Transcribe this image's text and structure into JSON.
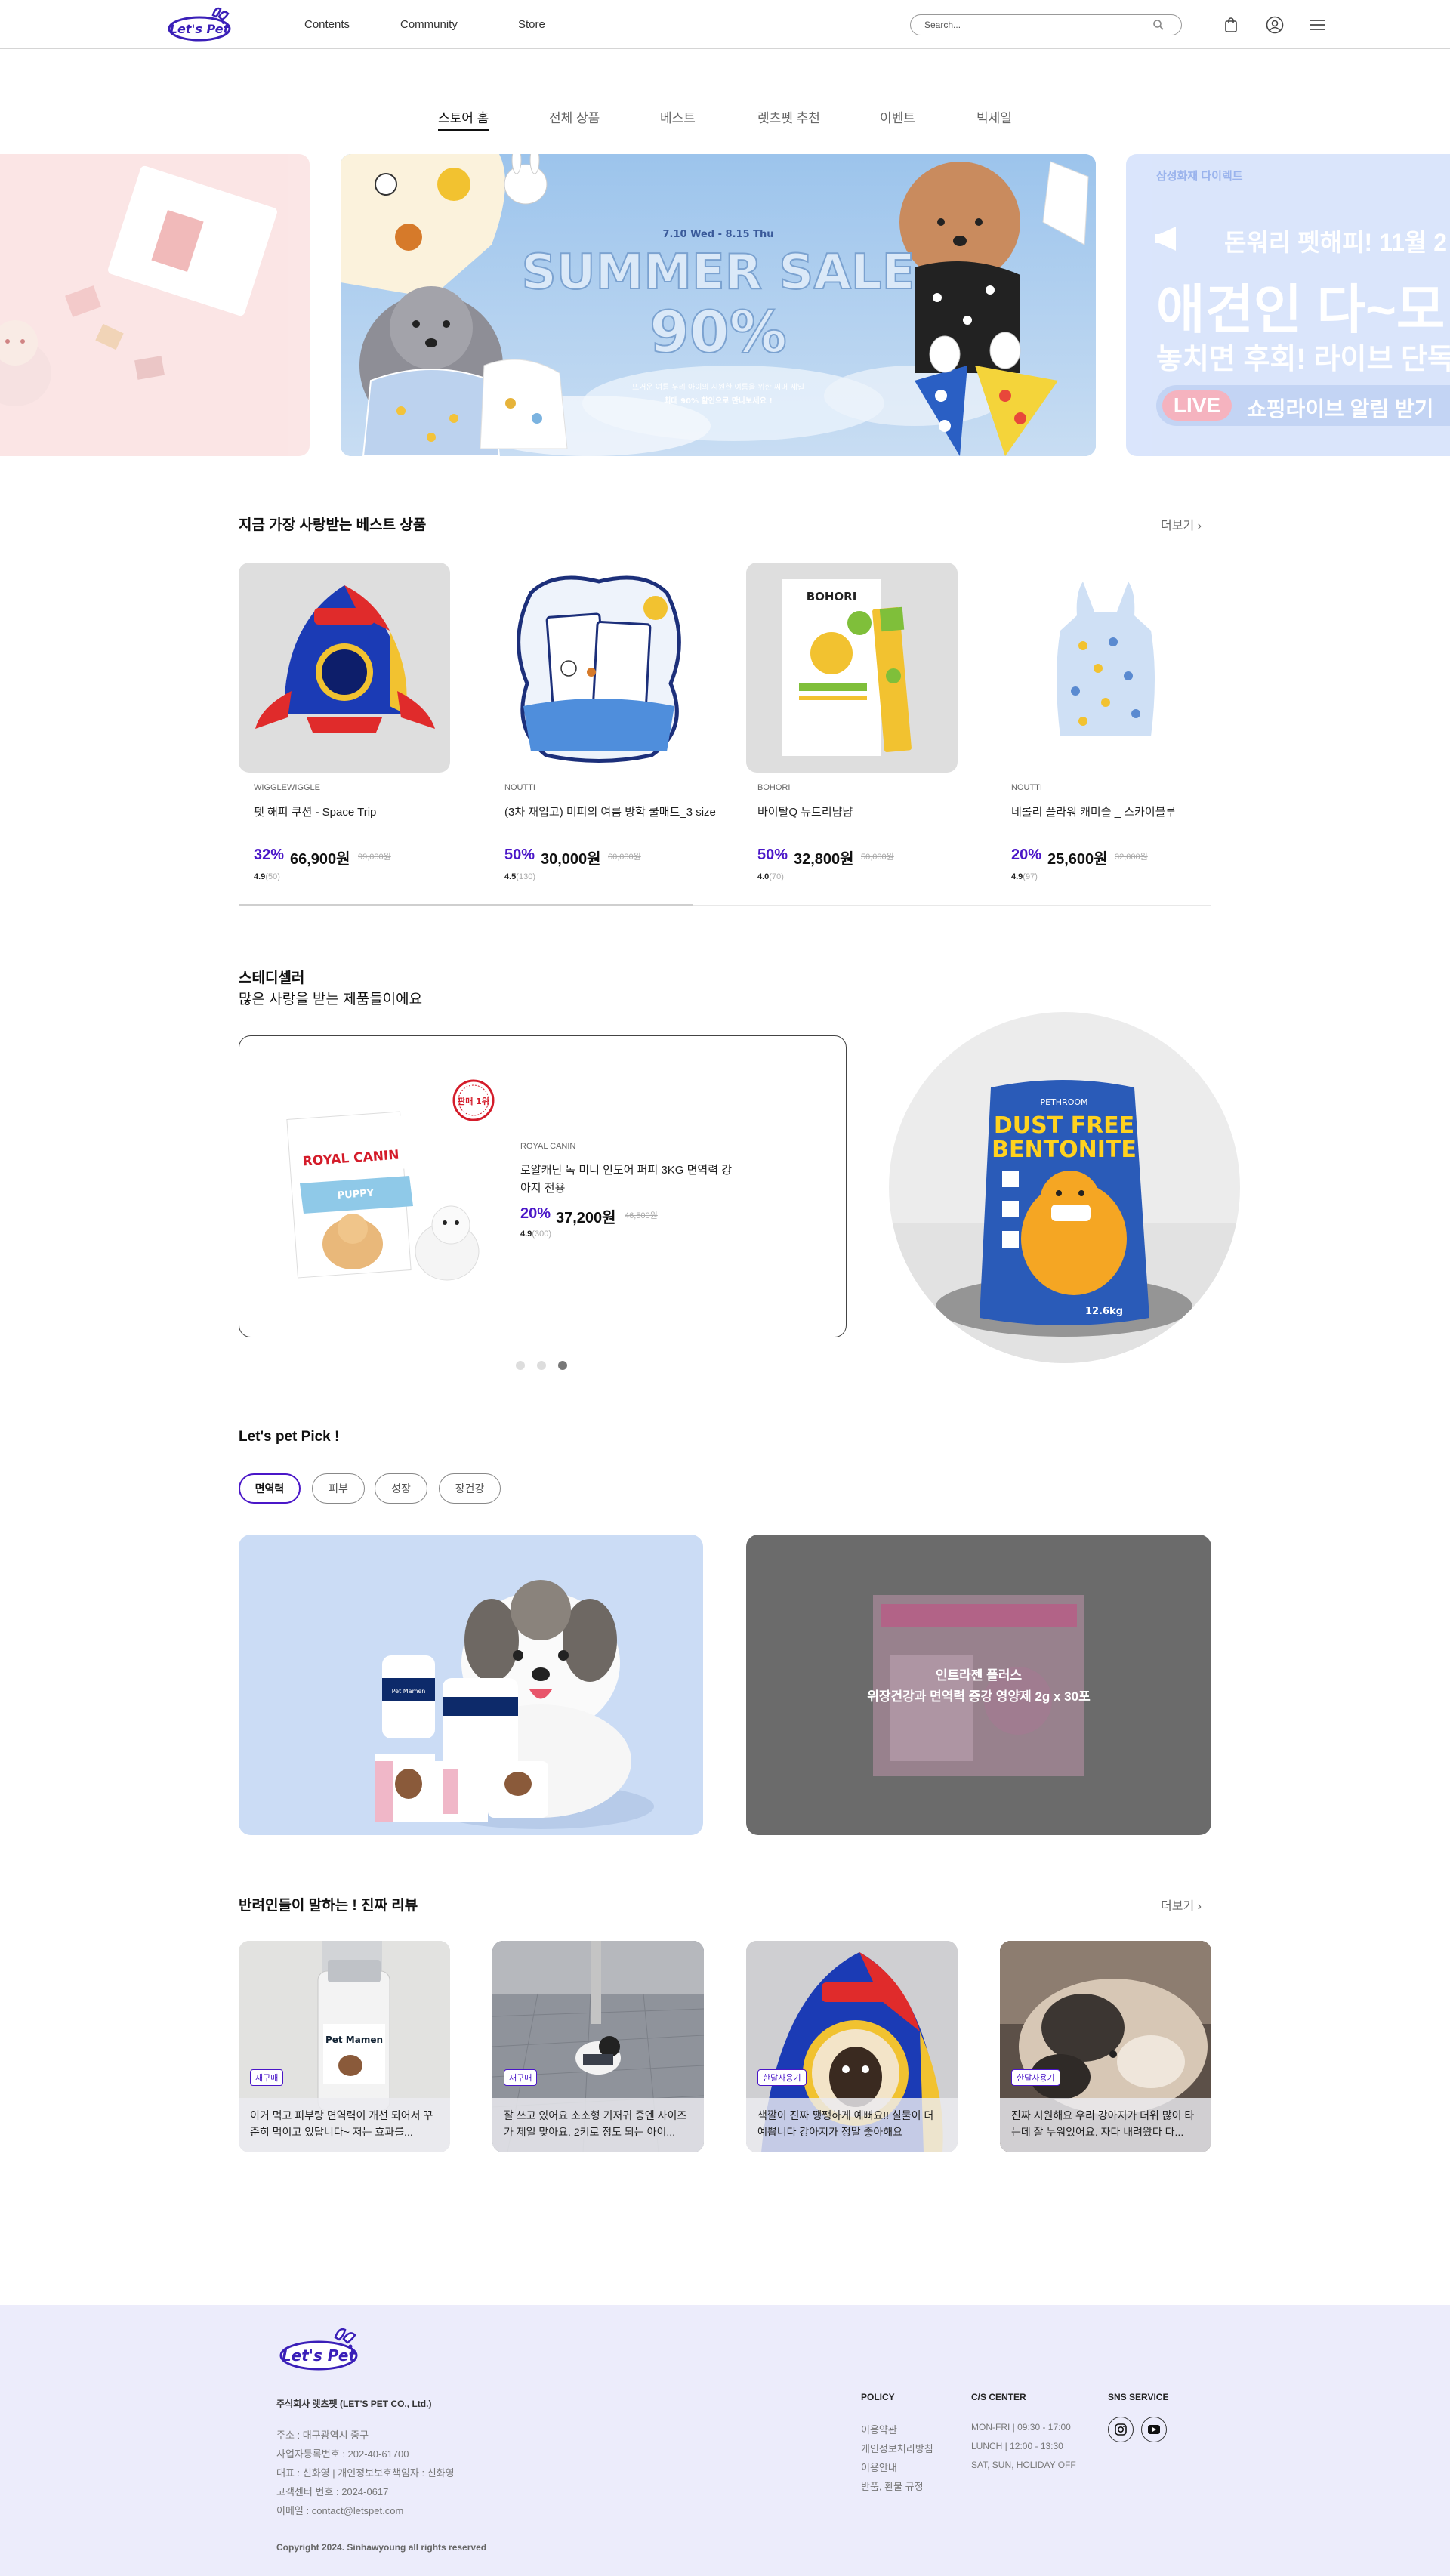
{
  "header": {
    "logo_text": "Let's Pet",
    "nav": [
      "Contents",
      "Community",
      "Store"
    ],
    "search_placeholder": "Search..."
  },
  "store_tabs": [
    "스토어 홈",
    "전체 상품",
    "베스트",
    "렛츠펫 추천",
    "이벤트",
    "빅세일"
  ],
  "banner_main": {
    "date": "7.10 Wed - 8.15 Thu",
    "title": "SUMMER SALE",
    "percent": "90%",
    "desc1": "뜨거운 여름 우리 아이의 시원한 여름을 위한 써머 세일",
    "desc2": "최대 90% 할인으로 만나보세요 !"
  },
  "banner_right": {
    "tag": "삼성화재 다이렉트",
    "line1": "돈워리 펫해피!  11월 2",
    "line2": "애견인 다~모",
    "line3": "놓치면 후회! 라이브 단독",
    "live": "LIVE",
    "live_text": "쇼핑라이브 알림 받기"
  },
  "best": {
    "title": "지금 가장 사랑받는 베스트 상품",
    "more": "더보기",
    "products": [
      {
        "brand": "WIGGLEWIGGLE",
        "name": "펫 해피 쿠션 - Space Trip",
        "discount": "32%",
        "price": "66,900원",
        "original": "99,000원",
        "rating": "4.9",
        "reviews": "(50)"
      },
      {
        "brand": "NOUTTI",
        "name": "(3차 재입고) 미피의 여름 방학 쿨매트_3 size",
        "discount": "50%",
        "price": "30,000원",
        "original": "60,000원",
        "rating": "4.5",
        "reviews": "(130)"
      },
      {
        "brand": "BOHORI",
        "name": "바이탈Q 뉴트리냠냠",
        "discount": "50%",
        "price": "32,800원",
        "original": "50,000원",
        "rating": "4.0",
        "reviews": "(70)"
      },
      {
        "brand": "NOUTTI",
        "name": "네롤리 플라워 캐미솔 _ 스카이블루",
        "discount": "20%",
        "price": "25,600원",
        "original": "32,000원",
        "rating": "4.9",
        "reviews": "(97)"
      }
    ]
  },
  "steady": {
    "title": "스테디셀러",
    "subtitle": "많은 사랑을 받는 제품들이에요",
    "product": {
      "brand": "ROYAL CANIN",
      "name": "로얄캐닌 독 미니 인도어 퍼피 3KG 면역력 강아지 전용",
      "discount": "20%",
      "price": "37,200원",
      "original": "46,500원",
      "rating": "4.9",
      "reviews": "(300)"
    },
    "pack_brand": "ROYAL CANIN",
    "pack_label": "PUPPY",
    "seal": "판매 1위",
    "side_pack": {
      "brand": "PETHROOM",
      "line1": "DUST FREE",
      "line2": "BENTONITE",
      "weight": "12.6kg"
    }
  },
  "pick": {
    "title": "Let's pet Pick !",
    "chips": [
      "면역력",
      "피부",
      "성장",
      "장건강"
    ],
    "overlay_line1": "인트라젠 플러스",
    "overlay_line2": "위장건강과 면역력 증강 영양제 2g x 30포",
    "left_product_label": "Pet Mamen"
  },
  "reviews": {
    "title": "반려인들이 말하는 ! 진짜 리뷰",
    "more": "더보기",
    "items": [
      {
        "badge": "재구매",
        "text": "이거 먹고 피부랑 면역력이 개선 되어서 꾸준히 먹이고 있답니다~ 저는 효과를..."
      },
      {
        "badge": "재구매",
        "text": "잘 쓰고 있어요 소소형 기저귀 중엔 사이즈가 제일 맞아요. 2키로 정도 되는 아이..."
      },
      {
        "badge": "한달사용기",
        "text": "색깔이 진짜 쨍쨍하게 예뻐요!! 실물이 더 예쁩니다 강아지가 정말 좋아해요"
      },
      {
        "badge": "한달사용기",
        "text": "진짜 시원해요 우리 강아지가 더위 많이 타는데 잘 누워있어요. 자다 내려왔다 다..."
      }
    ],
    "bottle_label": "Pet Mamen"
  },
  "footer": {
    "logo_text": "Let's Pet",
    "company": "주식회사 렛츠펫 (LET'S PET CO., Ltd.)",
    "info": [
      "주소 : 대구광역시 중구",
      "사업자등록번호 : 202-40-61700",
      "대표 : 신화영  |  개인정보보호책임자 : 신화영",
      "고객센터 번호 : 2024-0617",
      "이메일 : contact@letspet.com"
    ],
    "copyright": "Copyright 2024. Sinhawyoung all rights reserved",
    "policy_title": "POLICY",
    "policy": [
      "이용약관",
      "개인정보처리방침",
      "이용안내",
      "반품, 환불 규정"
    ],
    "cs_title": "C/S CENTER",
    "cs": [
      "MON-FRI | 09:30 - 17:00",
      "LUNCH | 12:00 - 13:30",
      "SAT, SUN, HOLIDAY OFF"
    ],
    "sns_title": "SNS SERVICE"
  },
  "colors": {
    "accent": "#4a16c8",
    "banner_blue": "#a9cbee",
    "footer_bg": "#ececfb",
    "overlay": "#6b6b6b"
  }
}
